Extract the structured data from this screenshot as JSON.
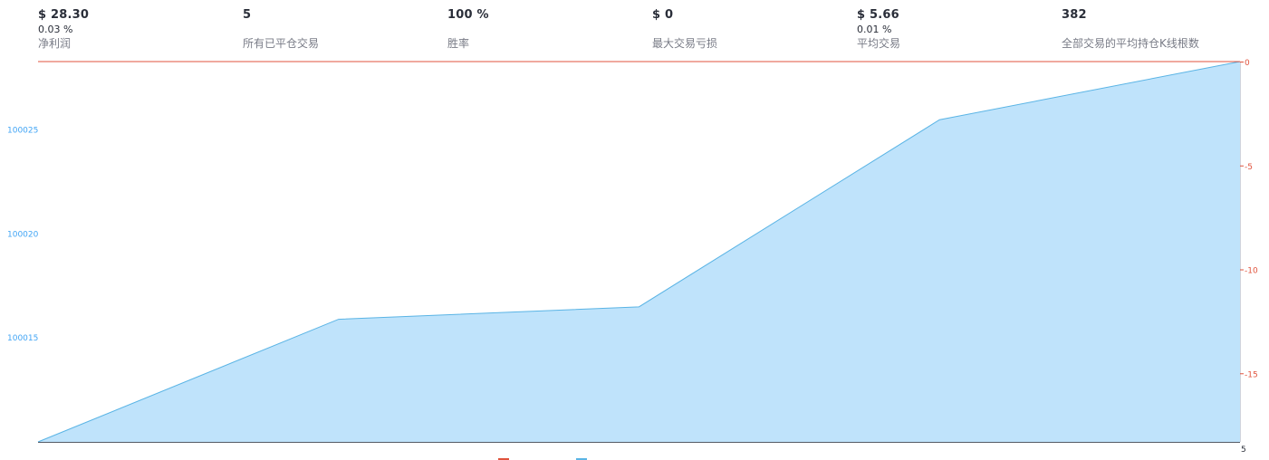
{
  "stats": [
    {
      "value": "$ 28.30",
      "pct": "0.03 %",
      "label": "净利润"
    },
    {
      "value": "5",
      "pct": "",
      "label": "所有已平仓交易"
    },
    {
      "value": "100 %",
      "pct": "",
      "label": "胜率"
    },
    {
      "value": "$ 0",
      "pct": "",
      "label": "最大交易亏损"
    },
    {
      "value": "$ 5.66",
      "pct": "0.01 %",
      "label": "平均交易"
    },
    {
      "value": "382",
      "pct": "",
      "label": "全部交易的平均持仓K线根数"
    }
  ],
  "colors": {
    "equity_fill": "#bfe3fb",
    "equity_line": "#5ab4e5",
    "drawdown_line": "#e0533d",
    "left_axis_text": "#42a5f5",
    "right_axis_text": "#e0533d"
  },
  "chart_data": {
    "type": "area",
    "x": [
      0,
      1,
      2,
      3,
      4,
      5
    ],
    "series": [
      {
        "values": [
          100010.0,
          100015.9,
          100016.5,
          100025.5,
          100028.3
        ],
        "x": [
          0,
          1,
          2,
          3,
          4
        ]
      }
    ],
    "drawdown_series": {
      "values": [
        0,
        0,
        0,
        0,
        0
      ]
    },
    "left_axis": {
      "ticks": [
        "100015",
        "100020",
        "100025"
      ],
      "tick_values": [
        100015,
        100020,
        100025
      ],
      "range": [
        100010.0,
        100028.3
      ]
    },
    "right_axis": {
      "ticks": [
        "0",
        "-5",
        "-10",
        "-15"
      ],
      "tick_values": [
        0,
        -5,
        -10,
        -15
      ],
      "range": [
        -18.3,
        0
      ]
    },
    "x_axis": {
      "ticks": [
        "5"
      ],
      "tick_values": [
        5
      ],
      "range": [
        0,
        4
      ]
    }
  }
}
